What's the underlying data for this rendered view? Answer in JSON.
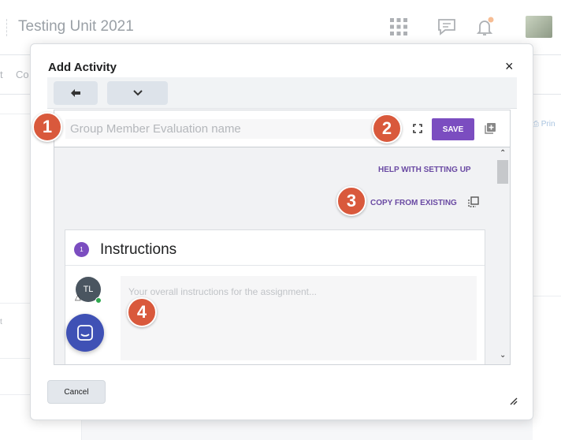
{
  "background": {
    "course_title": "Testing Unit 2021",
    "nav_items": [
      "t",
      "Co"
    ],
    "print_label": "Prin",
    "side_text": "t"
  },
  "dialog": {
    "title": "Add Activity",
    "close_label": "×",
    "toolbar": {
      "back_icon": "arrow-left-icon",
      "menu_icon": "chevron-down-icon"
    },
    "name_input": {
      "placeholder": "Group Member Evaluation name",
      "value": ""
    },
    "save_label": "SAVE",
    "help_link": "HELP WITH SETTING UP",
    "copy_link": "COPY FROM EXISTING",
    "section": {
      "step_number": "1",
      "title": "Instructions",
      "avatar_initials": "TL",
      "instructions_placeholder": "Your overall instructions for the assignment..."
    },
    "cancel_label": "Cancel"
  },
  "callouts": [
    "1",
    "2",
    "3",
    "4"
  ],
  "colors": {
    "accent": "#7b4dc0",
    "callout": "#d9593c",
    "chat": "#3f51b5"
  }
}
